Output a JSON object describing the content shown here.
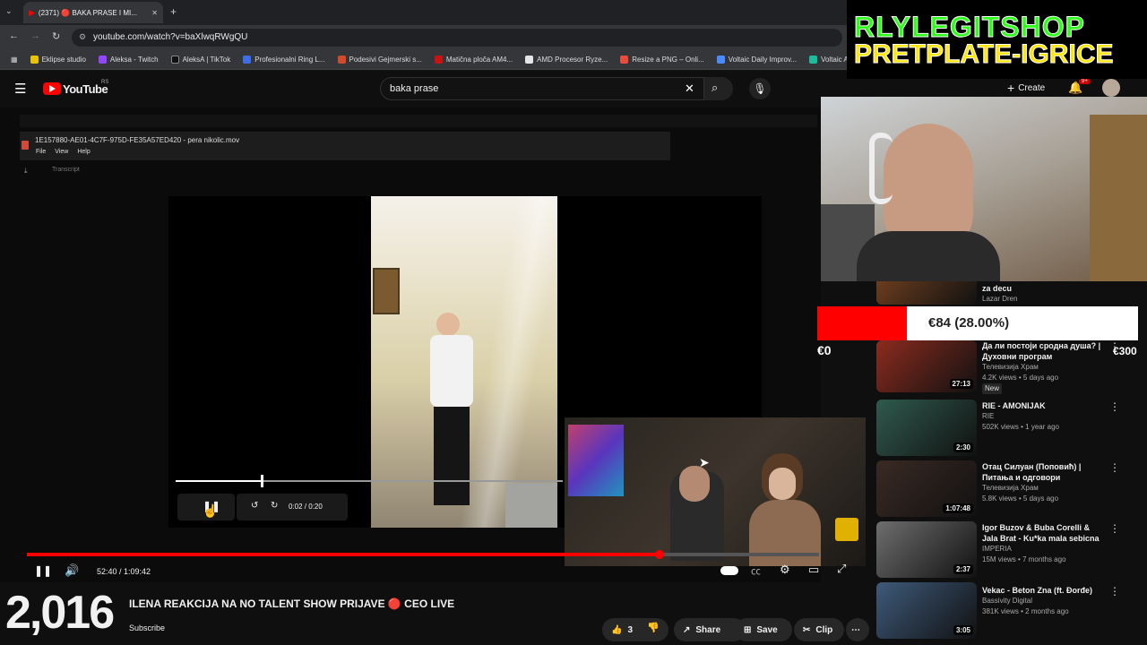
{
  "browser": {
    "tab_title": "(2371) 🔴 BAKA PRASE I MI...",
    "url": "youtube.com/watch?v=baXlwqRWgQU",
    "bookmarks": [
      "Eklipse studio",
      "Aleksa - Twitch",
      "AleksA | TikTok",
      "Profesionalni Ring L...",
      "Podesivi Gejmerski s...",
      "Matična ploča AM4...",
      "AMD Procesor Ryze...",
      "Resize a PNG – Onli...",
      "Voltaic Daily Improv...",
      "Voltaic App"
    ]
  },
  "youtube": {
    "logo_text": "YouTube",
    "region": "RS",
    "search_value": "baka prase",
    "create_label": "Create",
    "notif_count": "9+"
  },
  "inner_viewer": {
    "file_title": "1E157880-AE01-4C7F-975D-FE35A57ED420 - pera nikolic.mov",
    "menu": [
      "File",
      "View",
      "Help"
    ],
    "transcript_label": "Transcript",
    "time": "0:02 / 0:20"
  },
  "player": {
    "time": "52:40 / 1:09:42",
    "progress_fraction": 0.8
  },
  "video_info": {
    "viewer_count": "2,016",
    "title": "ILENA REAKCIJA NA NO TALENT SHOW PRIJAVE 🔴 CEO LIVE",
    "subscribe_label": "Subscribe",
    "like_count": "3",
    "share_label": "Share",
    "save_label": "Save",
    "clip_label": "Clip"
  },
  "overlay": {
    "banner_line1": "RLYLEGITSHOP",
    "banner_line2": "PRETPLATE-IGRICE",
    "goal_text": "€84 (28.00%)",
    "goal_min": "€0",
    "goal_max": "€300",
    "goal_fraction": 0.28
  },
  "recommendations": [
    {
      "title": "za decu",
      "meta1": "Lazar Dren",
      "meta2": "",
      "duration": "",
      "thumb_color": "#6b3d1e"
    },
    {
      "title": "Да ли постоји сродна душа? | Духовни програм",
      "meta1": "Телевизија Храм",
      "meta2": "4.2K views • 5 days ago",
      "badge": "New",
      "duration": "27:13",
      "thumb_color": "#8c2b1e"
    },
    {
      "title": "RIE - AMONIJAK",
      "meta1": "RIE",
      "meta2": "502K views • 1 year ago",
      "duration": "2:30",
      "thumb_color": "#2f5a4e"
    },
    {
      "title": "Отац Силуан (Поповић) | Питања и одговори",
      "meta1": "Телевизија Храм",
      "meta2": "5.8K views • 5 days ago",
      "duration": "1:07:48",
      "thumb_color": "#3a2a24"
    },
    {
      "title": "Igor Buzov & Buba Corelli & Jala Brat - Ku*ka mala sebicna",
      "meta1": "IMPERIA",
      "meta2": "15M views • 7 months ago",
      "duration": "2:37",
      "thumb_color": "#6e6e6e"
    },
    {
      "title": "Vekac - Beton Zna (ft. Đorđe)",
      "meta1": "Bassivity Digital",
      "meta2": "381K views • 2 months ago",
      "duration": "3:05",
      "thumb_color": "#3e5a7a"
    }
  ]
}
